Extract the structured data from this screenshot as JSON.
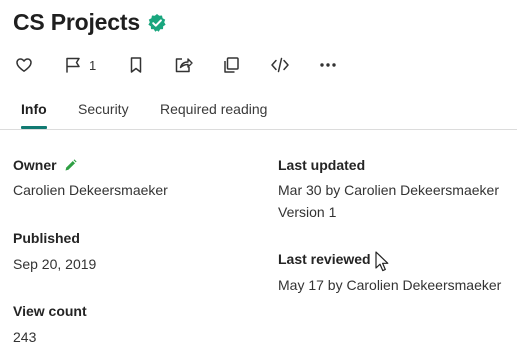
{
  "page": {
    "title": "CS Projects",
    "verified_badge_color": "#19a67e"
  },
  "actions": {
    "like_icon": "heart-icon",
    "comment_icon": "comment-flag-icon",
    "comment_count": "1",
    "bookmark_icon": "bookmark-icon",
    "share_icon": "share-icon",
    "copy_icon": "copy-icon",
    "embed_icon": "code-icon",
    "more_icon": "more-icon"
  },
  "tabs": [
    {
      "label": "Info",
      "active": true
    },
    {
      "label": "Security",
      "active": false
    },
    {
      "label": "Required reading",
      "active": false
    }
  ],
  "accent_color": "#117a72",
  "info": {
    "owner": {
      "label": "Owner",
      "value": "Carolien Dekeersmaeker"
    },
    "published": {
      "label": "Published",
      "value": "Sep 20, 2019"
    },
    "view_count": {
      "label": "View count",
      "value": "243"
    },
    "last_updated": {
      "label": "Last updated",
      "value": "Mar 30 by Carolien Dekeersmaeker",
      "version": "Version 1"
    },
    "last_reviewed": {
      "label": "Last reviewed",
      "value": "May 17 by Carolien Dekeersmaeker"
    }
  }
}
